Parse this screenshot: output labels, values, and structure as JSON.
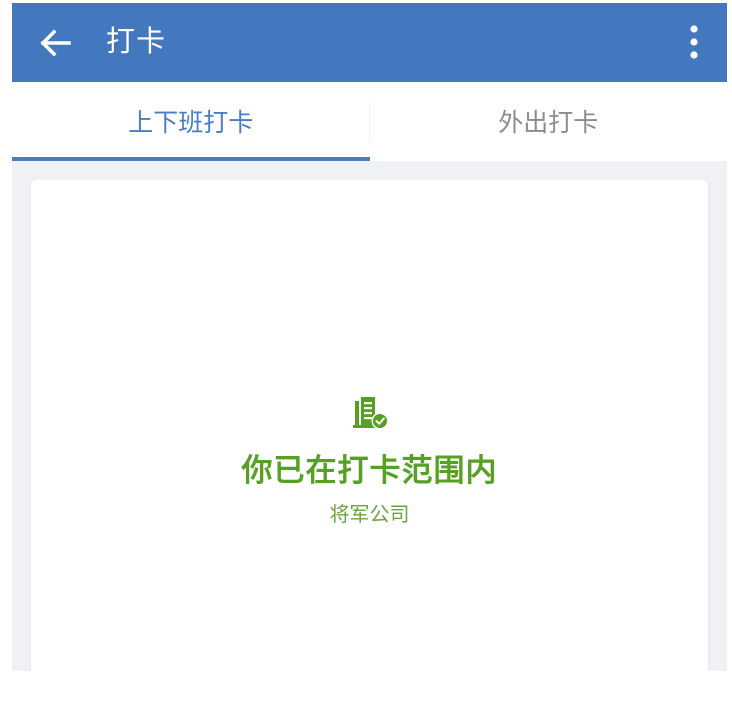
{
  "appbar": {
    "title": "打卡",
    "back_icon": "arrow-left-icon",
    "more_icon": "more-vertical-icon"
  },
  "tabs": [
    {
      "label": "上下班打卡",
      "active": true
    },
    {
      "label": "外出打卡",
      "active": false
    }
  ],
  "status": {
    "icon": "building-check-icon",
    "title": "你已在打卡范围内",
    "location": "将军公司"
  },
  "colors": {
    "primary": "#4378be",
    "tab_active": "#4a7ec4",
    "success": "#56a024",
    "background": "#eff1f4"
  }
}
